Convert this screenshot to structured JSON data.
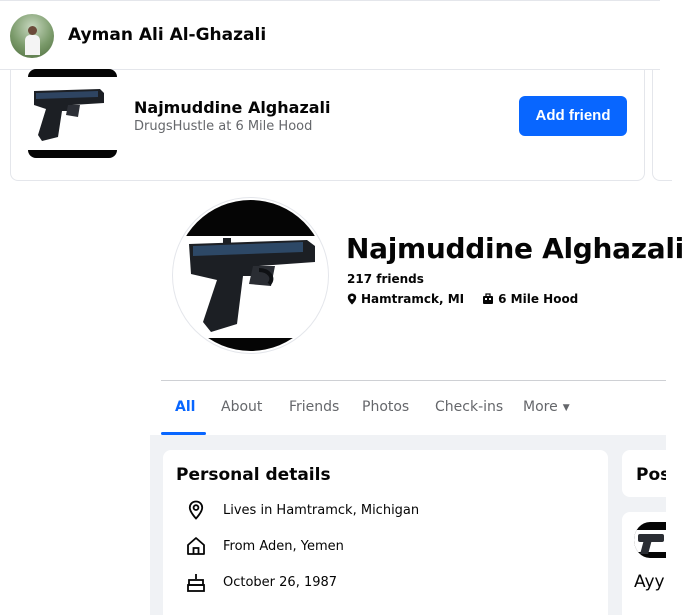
{
  "header": {
    "user_name": "Ayman Ali Al-Ghazali"
  },
  "suggestion": {
    "name": "Najmuddine Alghazali",
    "subtitle": "DrugsHustle at 6 Mile Hood",
    "add_friend_label": "Add friend"
  },
  "profile": {
    "name": "Najmuddine Alghazali",
    "friends": "217 friends",
    "location": "Hamtramck, MI",
    "workplace": "6 Mile Hood"
  },
  "tabs": [
    {
      "label": "All",
      "active": true
    },
    {
      "label": "About",
      "active": false
    },
    {
      "label": "Friends",
      "active": false
    },
    {
      "label": "Photos",
      "active": false
    },
    {
      "label": "Check-ins",
      "active": false
    },
    {
      "label": "More",
      "active": false
    }
  ],
  "personal_details": {
    "title": "Personal details",
    "items": [
      {
        "icon": "location-pin-icon",
        "text": "Lives in Hamtramck, Michigan"
      },
      {
        "icon": "home-icon",
        "text": "From Aden, Yemen"
      },
      {
        "icon": "birthday-cake-icon",
        "text": "October 26, 1987"
      }
    ]
  },
  "posts": {
    "title": "Pos",
    "author_partial": "Ayy"
  },
  "colors": {
    "accent": "#0866ff",
    "secondary_text": "#65676b",
    "page_background": "#f0f2f5"
  }
}
